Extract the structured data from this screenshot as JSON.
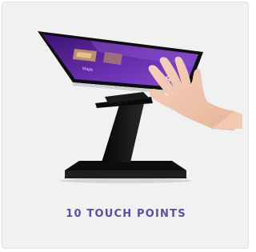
{
  "product": {
    "image_alt": "Touchscreen kiosk with hand touching screen",
    "screen_word": "Magic",
    "screen_logo": "DSW",
    "caption": "10 TOUCH POINTS"
  },
  "colors": {
    "caption": "#5a4fa8",
    "screen_dark": "#2b0f5c",
    "screen_light": "#7b3fbe",
    "stand": "#141414",
    "background": "#f1f1f1"
  }
}
